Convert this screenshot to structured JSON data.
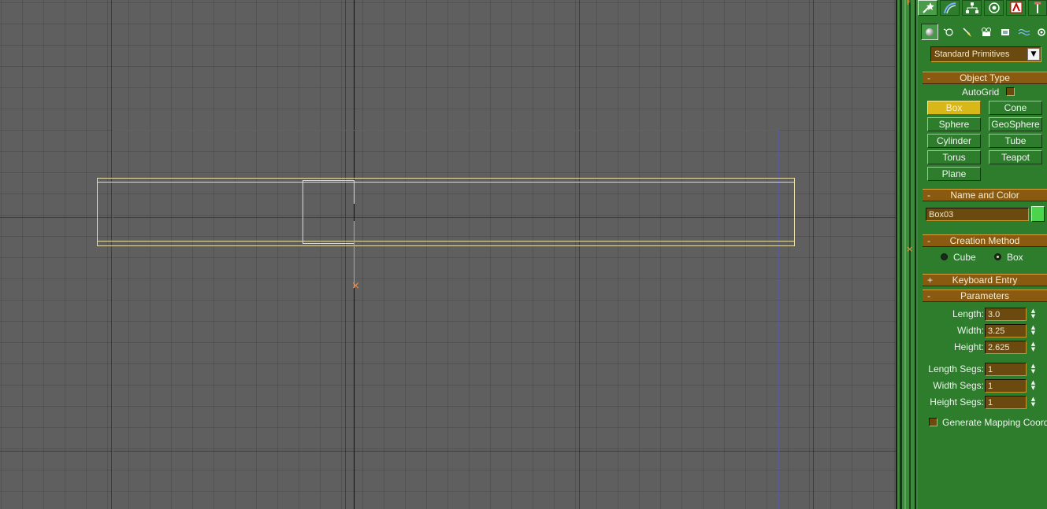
{
  "viewport": {
    "pivot_mark": "×"
  },
  "divider": {
    "marker": "×",
    "top_marker": "F"
  },
  "panel": {
    "tabs": [
      {
        "icon": "create-icon"
      },
      {
        "icon": "modify-icon"
      },
      {
        "icon": "hierarchy-icon"
      },
      {
        "icon": "motion-icon"
      },
      {
        "icon": "display-icon"
      },
      {
        "icon": "utilities-icon"
      }
    ],
    "subtabs": [
      {
        "icon": "geometry-icon"
      },
      {
        "icon": "shapes-icon"
      },
      {
        "icon": "lights-icon"
      },
      {
        "icon": "cameras-icon"
      },
      {
        "icon": "helpers-icon"
      },
      {
        "icon": "space-warps-icon"
      },
      {
        "icon": "systems-icon"
      }
    ],
    "category_dropdown": "Standard Primitives",
    "object_type": {
      "header": "Object Type",
      "sign": "-",
      "autogrid": "AutoGrid",
      "buttons": [
        "Box",
        "Cone",
        "Sphere",
        "GeoSphere",
        "Cylinder",
        "Tube",
        "Torus",
        "Teapot",
        "Plane"
      ],
      "active": "Box"
    },
    "name_color": {
      "header": "Name and Color",
      "sign": "-",
      "name": "Box03",
      "color": "#4cd44c"
    },
    "creation_method": {
      "header": "Creation Method",
      "sign": "-",
      "options": [
        "Cube",
        "Box"
      ],
      "selected": "Box"
    },
    "keyboard_entry": {
      "header": "Keyboard Entry",
      "sign": "+"
    },
    "parameters": {
      "header": "Parameters",
      "sign": "-",
      "length_label": "Length:",
      "length": "3.0",
      "width_label": "Width:",
      "width": "3.25",
      "height_label": "Height:",
      "height": "2.625",
      "length_segs_label": "Length Segs:",
      "length_segs": "1",
      "width_segs_label": "Width Segs:",
      "width_segs": "1",
      "height_segs_label": "Height Segs:",
      "height_segs": "1",
      "gen_mapping": "Generate Mapping Coords."
    }
  }
}
